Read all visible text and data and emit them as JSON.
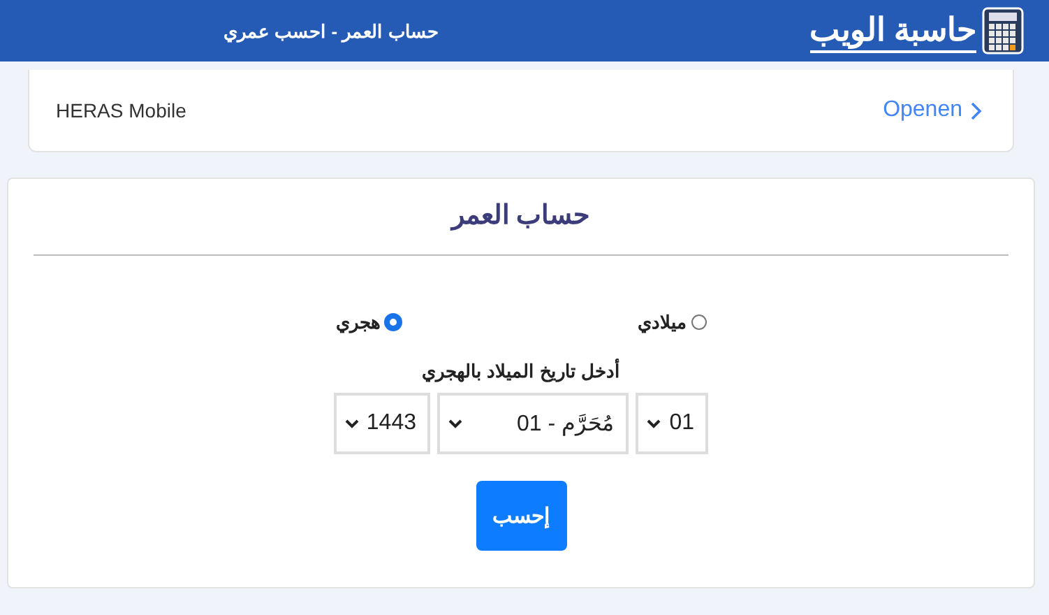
{
  "header": {
    "logo": "حاسبة الويب",
    "title": "حساب العمر - احسب عمري"
  },
  "ad": {
    "name": "HERAS Mobile",
    "action": "Openen"
  },
  "form": {
    "title": "حساب العمر",
    "calendars": [
      {
        "label": "ميلادي",
        "selected": false
      },
      {
        "label": "هجري",
        "selected": true
      }
    ],
    "prompt": "أدخل تاريخ الميلاد بالهجري",
    "selects": [
      {
        "value": "01"
      },
      {
        "value": "01 - مُحَرَّم"
      },
      {
        "value": "1443"
      }
    ],
    "submit": "إحسب"
  }
}
